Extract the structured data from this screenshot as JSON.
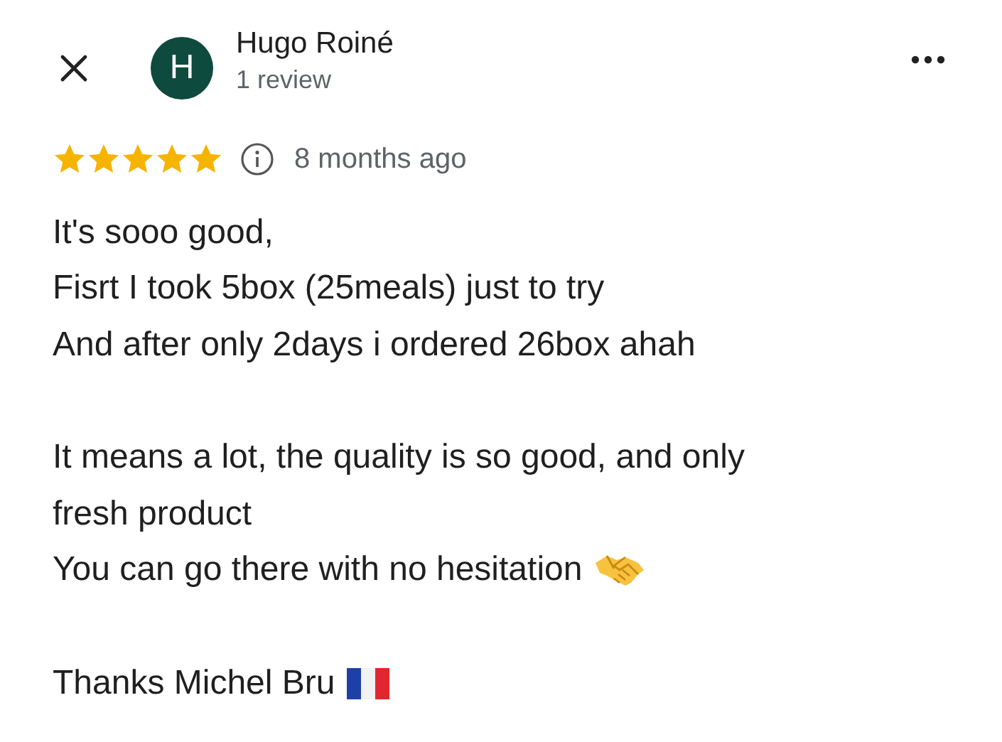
{
  "reviewer": {
    "initial": "H",
    "name": "Hugo Roiné",
    "meta": "1 review"
  },
  "rating": {
    "stars": 5,
    "time": "8 months ago"
  },
  "paragraphs": [
    {
      "lines": [
        {
          "kind": "plain",
          "text": "It's sooo good,"
        },
        {
          "kind": "plain",
          "text": "Fisrt I took 5box (25meals) just to try"
        },
        {
          "kind": "plain",
          "text": "And after only 2days i ordered 26box ahah"
        }
      ]
    },
    {
      "lines": [
        {
          "kind": "plain",
          "text": "It means a lot, the quality is so good, and only"
        },
        {
          "kind": "plain",
          "text": "fresh product"
        },
        {
          "kind": "handshake",
          "text": "You can go there with no hesitation"
        }
      ]
    },
    {
      "lines": [
        {
          "kind": "flag",
          "text": "Thanks Michel Bru"
        }
      ]
    }
  ]
}
